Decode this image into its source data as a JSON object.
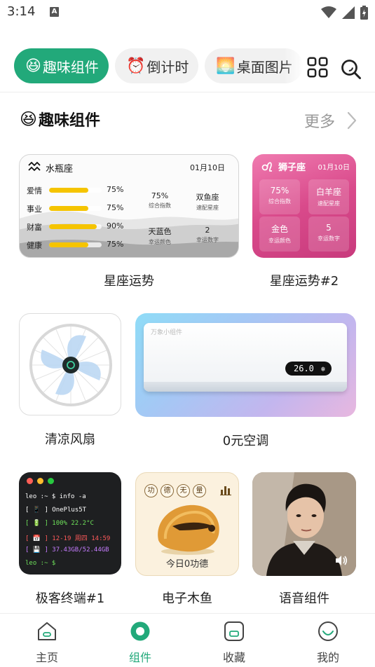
{
  "status_bar": {
    "time": "3:14",
    "notification_letter": "A"
  },
  "tabs": [
    {
      "emoji": "😆",
      "label": "趣味组件",
      "active": true
    },
    {
      "emoji": "⏰",
      "label": "倒计时",
      "active": false
    },
    {
      "emoji": "🌅",
      "label": "桌面图片",
      "active": false
    }
  ],
  "section": {
    "emoji": "😆",
    "title": "趣味组件",
    "more_label": "更多"
  },
  "widgets": {
    "aquarius": {
      "name": "水瓶座",
      "date": "01月10日",
      "rows": [
        {
          "name": "爱情",
          "percent": "75%",
          "fraction": 0.75
        },
        {
          "name": "事业",
          "percent": "75%",
          "fraction": 0.75
        },
        {
          "name": "财富",
          "percent": "90%",
          "fraction": 0.9
        },
        {
          "name": "健康",
          "percent": "75%",
          "fraction": 0.75
        }
      ],
      "cells": [
        {
          "value": "75%",
          "key": "综合指数"
        },
        {
          "value": "双鱼座",
          "key": "速配星座"
        },
        {
          "value": "天蓝色",
          "key": "幸运颜色"
        },
        {
          "value": "2",
          "key": "幸运数字"
        }
      ],
      "label": "星座运势"
    },
    "leo": {
      "name": "狮子座",
      "date": "01月10日",
      "cells": [
        {
          "value": "75%",
          "key": "综合指数"
        },
        {
          "value": "白羊座",
          "key": "速配星座"
        },
        {
          "value": "金色",
          "key": "幸运颜色"
        },
        {
          "value": "5",
          "key": "幸运数字"
        }
      ],
      "label": "星座运势#2"
    },
    "fan": {
      "label": "清凉风扇"
    },
    "ac": {
      "watermark": "万象小组件",
      "temperature": "26.0",
      "label": "0元空调"
    },
    "terminal": {
      "lines": [
        {
          "text": "leo :~ $ info -a",
          "color": "#ffffff"
        },
        {
          "text": "[ 📱 ] OnePlus5T",
          "color": "#ffffff"
        },
        {
          "text": "[ 🔋 ] 100% 22.2°C",
          "color": "#6ee05a"
        },
        {
          "text": "[ 📅 ] 12-19 周四 14:59",
          "color": "#ff5a5a"
        },
        {
          "text": "[ 💾 ] 37.43GB/52.44GB",
          "color": "#c67cff"
        },
        {
          "text": "leo :~ $",
          "color": "#6ee05a"
        }
      ],
      "label": "极客终端#1"
    },
    "wooden_fish": {
      "chars": [
        "功",
        "德",
        "无",
        "量"
      ],
      "count_text": "今日0功德",
      "label": "电子木鱼"
    },
    "voice": {
      "label": "语音组件"
    }
  },
  "nav": [
    {
      "label": "主页",
      "active": false
    },
    {
      "label": "组件",
      "active": true
    },
    {
      "label": "收藏",
      "active": false
    },
    {
      "label": "我的",
      "active": false
    }
  ],
  "colors": {
    "accent": "#22a97a",
    "leo_pink": "#d94a8b",
    "bar_yellow": "#f5c400"
  }
}
